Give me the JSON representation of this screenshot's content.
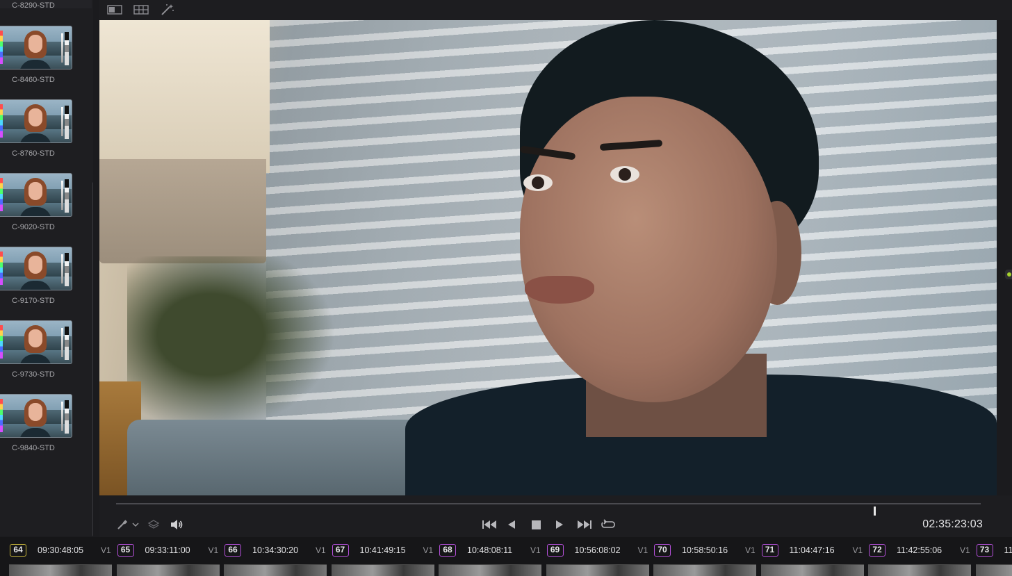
{
  "gallery": {
    "top_label": "C-8290-STD",
    "stills": [
      {
        "label": "C-8460-STD"
      },
      {
        "label": "C-8760-STD"
      },
      {
        "label": "C-9020-STD"
      },
      {
        "label": "C-9170-STD"
      },
      {
        "label": "C-9730-STD"
      },
      {
        "label": "C-9840-STD"
      }
    ]
  },
  "viewer_toolbar": {
    "icons": [
      "single-viewer-icon",
      "split-viewer-icon",
      "magic-wand-icon"
    ]
  },
  "transport": {
    "timecode": "02:35:23:03",
    "progress_fraction": 0.876,
    "left_icons": [
      "picker-tool-icon",
      "dropdown-chevron-icon",
      "layers-icon",
      "speaker-icon"
    ],
    "buttons": [
      "skip-to-start-icon",
      "play-reverse-icon",
      "stop-icon",
      "play-icon",
      "skip-to-end-icon",
      "loop-icon"
    ]
  },
  "clips": [
    {
      "num": "64",
      "timecode": "09:30:48:05",
      "track": "V1",
      "color": "#c6b43a"
    },
    {
      "num": "65",
      "timecode": "09:33:11:00",
      "track": "V1",
      "color": "#b34fd8"
    },
    {
      "num": "66",
      "timecode": "10:34:30:20",
      "track": "V1",
      "color": "#b34fd8"
    },
    {
      "num": "67",
      "timecode": "10:41:49:15",
      "track": "V1",
      "color": "#b34fd8"
    },
    {
      "num": "68",
      "timecode": "10:48:08:11",
      "track": "V1",
      "color": "#b34fd8"
    },
    {
      "num": "69",
      "timecode": "10:56:08:02",
      "track": "V1",
      "color": "#b34fd8"
    },
    {
      "num": "70",
      "timecode": "10:58:50:16",
      "track": "V1",
      "color": "#b34fd8"
    },
    {
      "num": "71",
      "timecode": "11:04:47:16",
      "track": "V1",
      "color": "#b34fd8"
    },
    {
      "num": "72",
      "timecode": "11:42:55:06",
      "track": "V1",
      "color": "#b34fd8"
    },
    {
      "num": "73",
      "timecode": "11",
      "track": "",
      "color": "#b34fd8"
    }
  ]
}
